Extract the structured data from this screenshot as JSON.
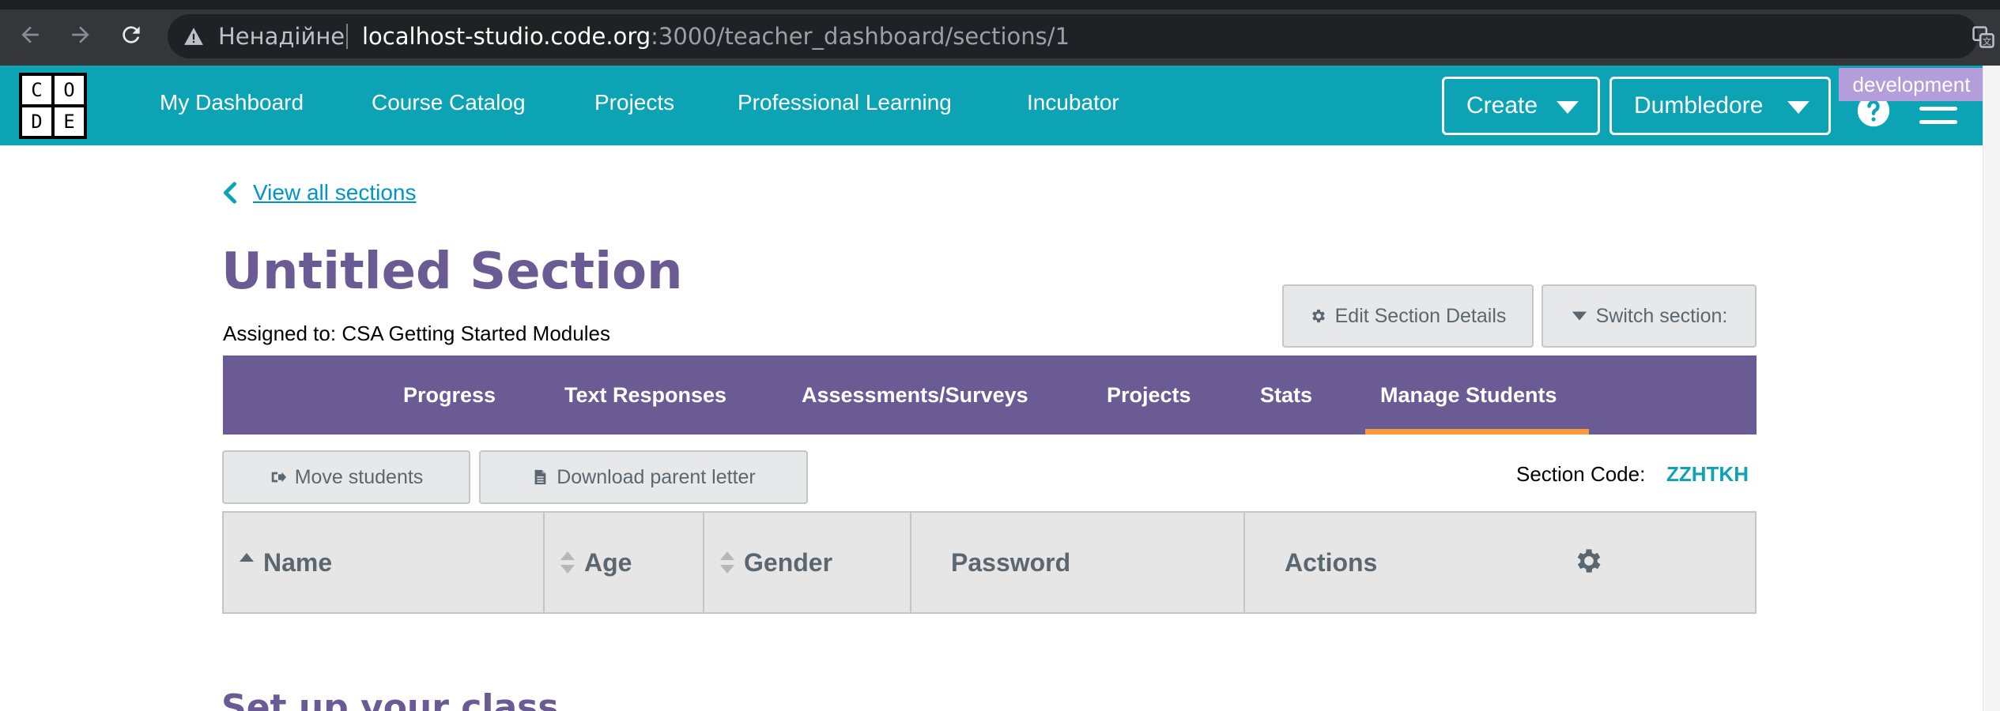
{
  "browser": {
    "security_label": "Ненадійне",
    "url_host": "localhost-studio.code.org",
    "url_path": ":3000/teacher_dashboard/sections/1"
  },
  "header": {
    "logo_letters": [
      "C",
      "O",
      "D",
      "E"
    ],
    "nav": [
      "My Dashboard",
      "Course Catalog",
      "Projects",
      "Professional Learning",
      "Incubator"
    ],
    "create_label": "Create",
    "user_label": "Dumbledore",
    "env_badge": "development",
    "brand_color": "#0ca4b4"
  },
  "page": {
    "back_link": "View all sections",
    "title": "Untitled Section",
    "assigned": "Assigned to: CSA Getting Started Modules",
    "edit_button": "Edit Section Details",
    "switch_button": "Switch section:",
    "tabs": [
      "Progress",
      "Text Responses",
      "Assessments/Surveys",
      "Projects",
      "Stats",
      "Manage Students"
    ],
    "active_tab": "Manage Students",
    "move_button": "Move students",
    "download_button": "Download parent letter",
    "section_code_label": "Section Code:",
    "section_code": "ZZHTKH",
    "table_headers": [
      "Name",
      "Age",
      "Gender",
      "Password",
      "Actions"
    ],
    "setup_title": "Set up your class",
    "accent_purple": "#6b5b95",
    "tab_highlight": "#ff9a3c"
  }
}
